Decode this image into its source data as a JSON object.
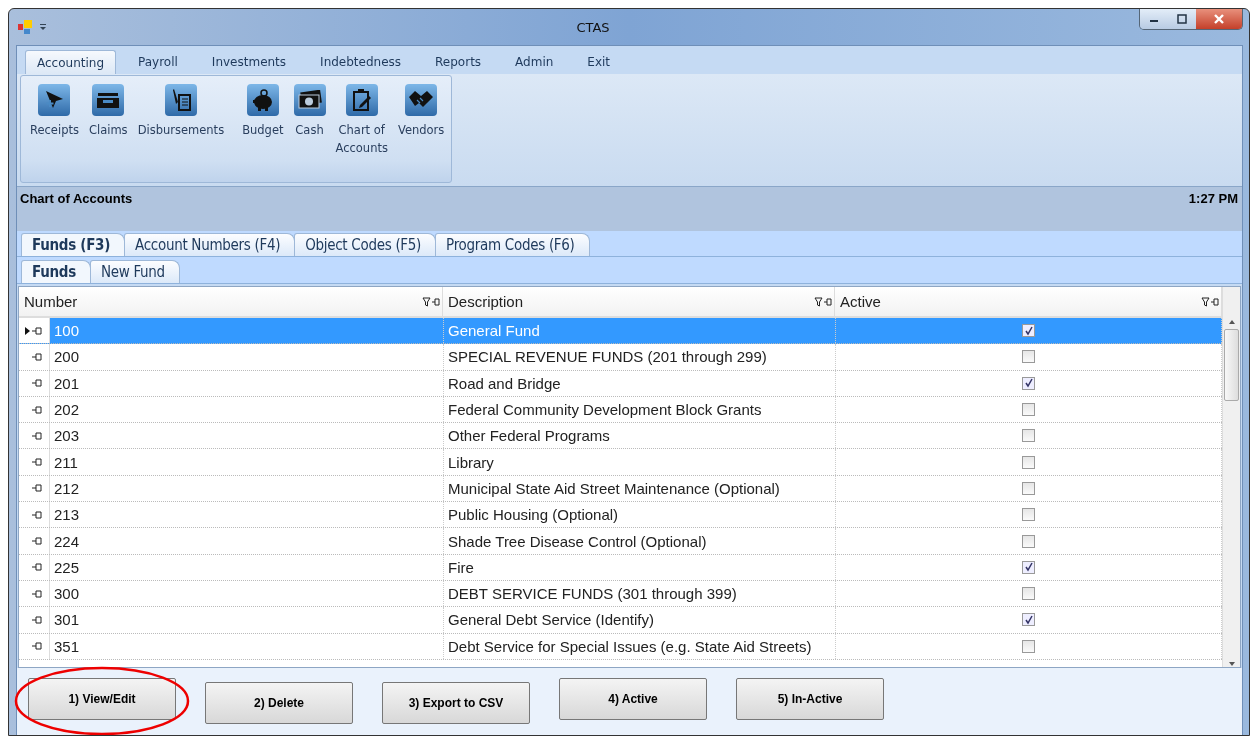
{
  "window": {
    "title": "CTAS"
  },
  "menu": [
    {
      "label": "Accounting",
      "selected": true
    },
    {
      "label": "Payroll",
      "selected": false
    },
    {
      "label": "Investments",
      "selected": false
    },
    {
      "label": "Indebtedness",
      "selected": false
    },
    {
      "label": "Reports",
      "selected": false
    },
    {
      "label": "Admin",
      "selected": false
    },
    {
      "label": "Exit",
      "selected": false
    }
  ],
  "ribbon": [
    {
      "label": "Receipts",
      "kind": "receipt"
    },
    {
      "label": "Claims",
      "kind": "tray"
    },
    {
      "label": "Disbursements",
      "kind": "pen"
    },
    {
      "label": "Budget",
      "kind": "piggy"
    },
    {
      "label": "Cash",
      "kind": "cash"
    },
    {
      "label": "Chart of Accounts",
      "kind": "clipboard"
    },
    {
      "label": "Vendors",
      "kind": "handshake"
    }
  ],
  "header": {
    "title": "Chart of Accounts",
    "time": "1:27 PM"
  },
  "tabs": [
    {
      "label": "Funds (F3)",
      "selected": true
    },
    {
      "label": "Account Numbers (F4)",
      "selected": false
    },
    {
      "label": "Object Codes (F5)",
      "selected": false
    },
    {
      "label": "Program Codes (F6)",
      "selected": false
    }
  ],
  "subtabs": [
    {
      "label": "Funds",
      "selected": true
    },
    {
      "label": "New Fund",
      "selected": false
    }
  ],
  "table": {
    "columns": [
      "Number",
      "Description",
      "Active"
    ],
    "rows": [
      {
        "number": "100",
        "description": "General Fund",
        "active": true,
        "selected": true
      },
      {
        "number": "200",
        "description": "SPECIAL REVENUE FUNDS (201 through 299)",
        "active": false,
        "selected": false
      },
      {
        "number": "201",
        "description": "Road and Bridge",
        "active": true,
        "selected": false
      },
      {
        "number": "202",
        "description": "Federal Community Development Block Grants",
        "active": false,
        "selected": false
      },
      {
        "number": "203",
        "description": "Other Federal Programs",
        "active": false,
        "selected": false
      },
      {
        "number": "211",
        "description": "Library",
        "active": false,
        "selected": false
      },
      {
        "number": "212",
        "description": "Municipal State Aid Street Maintenance (Optional)",
        "active": false,
        "selected": false
      },
      {
        "number": "213",
        "description": "Public Housing (Optional)",
        "active": false,
        "selected": false
      },
      {
        "number": "224",
        "description": "Shade Tree Disease Control (Optional)",
        "active": false,
        "selected": false
      },
      {
        "number": "225",
        "description": "Fire",
        "active": true,
        "selected": false
      },
      {
        "number": "300",
        "description": "DEBT SERVICE FUNDS (301 through 399)",
        "active": false,
        "selected": false
      },
      {
        "number": "301",
        "description": "General Debt Service (Identify)",
        "active": true,
        "selected": false
      },
      {
        "number": "351",
        "description": "Debt Service for Special Issues (e.g. State Aid Streets)",
        "active": false,
        "selected": false
      }
    ]
  },
  "buttons": [
    {
      "label": "1) View/Edit",
      "circled": true
    },
    {
      "label": "2) Delete",
      "circled": false
    },
    {
      "label": "3) Export to CSV",
      "circled": false
    },
    {
      "label": "4) Active",
      "circled": false
    },
    {
      "label": "5) In-Active",
      "circled": false
    }
  ]
}
